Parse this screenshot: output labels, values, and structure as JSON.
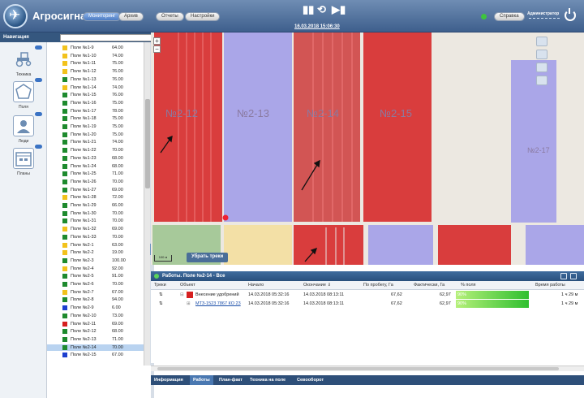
{
  "header": {
    "app_title": "Агросигнал",
    "buttons": [
      "Мониторинг",
      "Архив",
      "Отчеты",
      "Настройки"
    ],
    "datetime": "16.03.2018 15:06:30",
    "help_label": "Справка",
    "user_label": "Администратор",
    "play_controls": [
      "▮▮",
      "⟲",
      "▶▮"
    ]
  },
  "nav": {
    "title": "Навигация",
    "search_placeholder": ""
  },
  "sidebar": {
    "items": [
      {
        "label": "Техника",
        "icon": "tractor-icon"
      },
      {
        "label": "Поля",
        "icon": "field-polygon-icon"
      },
      {
        "label": "Люди",
        "icon": "people-icon"
      },
      {
        "label": "Планы",
        "icon": "calendar-icon"
      }
    ]
  },
  "fields": [
    {
      "name": "Поле №1-9",
      "value": "64.00",
      "color": "#f2c21c"
    },
    {
      "name": "Поле №1-10",
      "value": "74.00",
      "color": "#f2c21c"
    },
    {
      "name": "Поле №1-11",
      "value": "75.00",
      "color": "#f2c21c"
    },
    {
      "name": "Поле №1-12",
      "value": "76.00",
      "color": "#f2c21c"
    },
    {
      "name": "Поле №1-13",
      "value": "76.00",
      "color": "#1e8a2e"
    },
    {
      "name": "Поле №1-14",
      "value": "74.00",
      "color": "#f2c21c"
    },
    {
      "name": "Поле №1-15",
      "value": "76.00",
      "color": "#1e8a2e"
    },
    {
      "name": "Поле №1-16",
      "value": "75.00",
      "color": "#1e8a2e"
    },
    {
      "name": "Поле №1-17",
      "value": "78.00",
      "color": "#1e8a2e"
    },
    {
      "name": "Поле №1-18",
      "value": "75.00",
      "color": "#1e8a2e"
    },
    {
      "name": "Поле №1-19",
      "value": "75.00",
      "color": "#1e8a2e"
    },
    {
      "name": "Поле №1-20",
      "value": "75.00",
      "color": "#1e8a2e"
    },
    {
      "name": "Поле №1-21",
      "value": "74.00",
      "color": "#1e8a2e"
    },
    {
      "name": "Поле №1-22",
      "value": "70.00",
      "color": "#1e8a2e"
    },
    {
      "name": "Поле №1-23",
      "value": "68.00",
      "color": "#1e8a2e"
    },
    {
      "name": "Поле №1-24",
      "value": "68.00",
      "color": "#1e8a2e"
    },
    {
      "name": "Поле №1-25",
      "value": "71.00",
      "color": "#1e8a2e"
    },
    {
      "name": "Поле №1-26",
      "value": "70.00",
      "color": "#1e8a2e"
    },
    {
      "name": "Поле №1-27",
      "value": "69.00",
      "color": "#1e8a2e"
    },
    {
      "name": "Поле №1-28",
      "value": "72.00",
      "color": "#f2c21c"
    },
    {
      "name": "Поле №1-29",
      "value": "66.00",
      "color": "#1e8a2e"
    },
    {
      "name": "Поле №1-30",
      "value": "70.00",
      "color": "#1e8a2e"
    },
    {
      "name": "Поле №1-31",
      "value": "70.00",
      "color": "#1e8a2e"
    },
    {
      "name": "Поле №1-32",
      "value": "69.00",
      "color": "#f2c21c"
    },
    {
      "name": "Поле №1-33",
      "value": "70.00",
      "color": "#1e8a2e"
    },
    {
      "name": "Поле №2-1",
      "value": "63.00",
      "color": "#f2c21c"
    },
    {
      "name": "Поле №2-2",
      "value": "19.00",
      "color": "#f2c21c"
    },
    {
      "name": "Поле №2-3",
      "value": "100.00",
      "color": "#1e8a2e"
    },
    {
      "name": "Поле №2-4",
      "value": "92.00",
      "color": "#f2c21c"
    },
    {
      "name": "Поле №2-5",
      "value": "91.00",
      "color": "#1e8a2e"
    },
    {
      "name": "Поле №2-6",
      "value": "70.00",
      "color": "#1e8a2e"
    },
    {
      "name": "Поле №2-7",
      "value": "67.00",
      "color": "#f2c21c"
    },
    {
      "name": "Поле №2-8",
      "value": "94.00",
      "color": "#1e8a2e"
    },
    {
      "name": "Поле №2-9",
      "value": "6.00",
      "color": "#1d3fcf"
    },
    {
      "name": "Поле №2-10",
      "value": "73.00",
      "color": "#1e8a2e"
    },
    {
      "name": "Поле №2-11",
      "value": "69.00",
      "color": "#d62020"
    },
    {
      "name": "Поле №2-12",
      "value": "68.00",
      "color": "#1e8a2e"
    },
    {
      "name": "Поле №2-13",
      "value": "71.00",
      "color": "#1e8a2e"
    },
    {
      "name": "Поле №2-14",
      "value": "70.00",
      "color": "#1e8a2e",
      "selected": true
    },
    {
      "name": "Поле №2-15",
      "value": "67.00",
      "color": "#1d3fcf"
    }
  ],
  "map": {
    "labels": [
      "№2-12",
      "№2-13",
      "№2-14",
      "№2-15",
      "№2-17"
    ],
    "remove_tracks_label": "Убрать треки",
    "scale_label": "100 м"
  },
  "panel": {
    "title": "Работы. Поле №2-14 - Все",
    "columns": [
      "Треки",
      "Объект",
      "Начало",
      "Окончание ⇓",
      "По пробегу, Га",
      "Фактически, Га",
      "% поля",
      "Время работы"
    ],
    "rows": [
      {
        "object": "Внесение удобрений",
        "start": "14.03.2018 05:32:16",
        "end": "14.03.2018 08:13:11",
        "by_mileage": "67,62",
        "actual": "62,97",
        "pct": "90%",
        "time": "1 ч 29 м"
      },
      {
        "object": "МТЗ-1523 7867 КО 23",
        "start": "14.03.2018 05:32:16",
        "end": "14.03.2018 08:13:11",
        "by_mileage": "67,62",
        "actual": "62,97",
        "pct": "90%",
        "time": "1 ч 29 м"
      }
    ]
  },
  "tabs": [
    "Информация",
    "Работы",
    "План-факт",
    "Техника на поле",
    "Севооборот"
  ],
  "colors": {
    "accent": "#3e5f8d",
    "field_red": "#d33a3a",
    "field_purple": "#a9a4e6",
    "field_green": "#a7c99a",
    "field_yellow": "#f3e0a6"
  }
}
